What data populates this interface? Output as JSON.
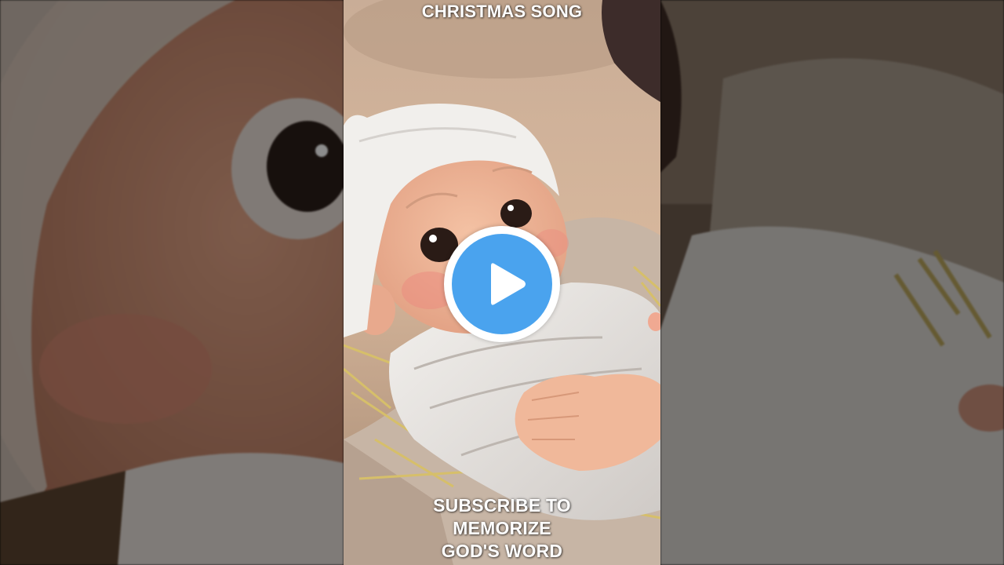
{
  "video": {
    "top_caption": "CHRISTMAS SONG",
    "bottom_caption_lines": [
      "SUBSCRIBE TO",
      "MEMORIZE",
      "GOD'S WORD"
    ]
  },
  "play_button": {
    "icon": "play-icon",
    "color": "#4aa3ee"
  }
}
